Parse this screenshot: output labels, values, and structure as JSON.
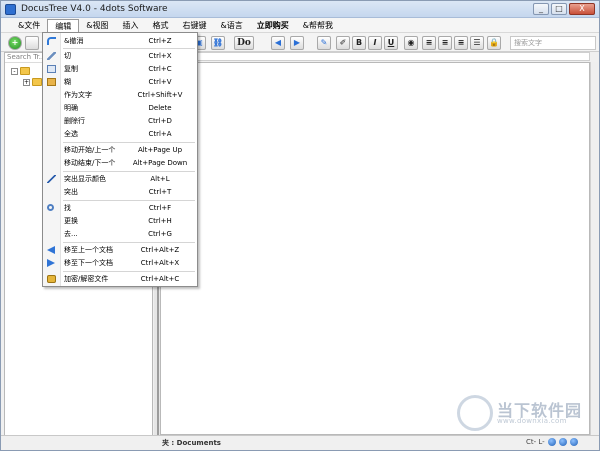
{
  "window": {
    "title": "DocusTree V4.0 - 4dots Software",
    "buttons": [
      "_",
      "□",
      "X"
    ]
  },
  "menubar": {
    "items": [
      "&文件",
      "编辑",
      "&视图",
      "插入",
      "格式",
      "右键键",
      "&语言",
      "立即购买",
      "&帮帮我"
    ],
    "active_index": 1
  },
  "toolbar": {
    "do_label": "Do",
    "bold_label": "B",
    "italic_label": "I",
    "underline_label": "U",
    "search_placeholder": "搜索文字"
  },
  "left_panel": {
    "search_placeholder": "Search Tr...",
    "tree_expand": "-",
    "tree_expand2": "+"
  },
  "edit_menu": {
    "items": [
      {
        "label": "&撤消",
        "shortcut": "Ctrl+Z",
        "icon": "undo-icon"
      },
      {
        "label": "切",
        "shortcut": "Ctrl+X",
        "icon": "cut-icon"
      },
      {
        "label": "复制",
        "shortcut": "Ctrl+C",
        "icon": "copy-icon"
      },
      {
        "label": "糊",
        "shortcut": "Ctrl+V",
        "icon": "paste-icon"
      },
      {
        "label": "作为文字",
        "shortcut": "Ctrl+Shift+V",
        "icon": ""
      },
      {
        "label": "明确",
        "shortcut": "Delete",
        "icon": ""
      },
      {
        "label": "删除行",
        "shortcut": "Ctrl+D",
        "icon": ""
      },
      {
        "label": "全选",
        "shortcut": "Ctrl+A",
        "icon": ""
      },
      {
        "label": "移动开始/上一个",
        "shortcut": "Alt+Page Up",
        "icon": ""
      },
      {
        "label": "移动结束/下一个",
        "shortcut": "Alt+Page Down",
        "icon": ""
      },
      {
        "label": "突出显示颜色",
        "shortcut": "Alt+L",
        "icon": "pen-icon"
      },
      {
        "label": "突出",
        "shortcut": "Ctrl+T",
        "icon": ""
      },
      {
        "label": "找",
        "shortcut": "Ctrl+F",
        "icon": "find-icon"
      },
      {
        "label": "更换",
        "shortcut": "Ctrl+H",
        "icon": ""
      },
      {
        "label": "去...",
        "shortcut": "Ctrl+G",
        "icon": ""
      },
      {
        "label": "移至上一个文档",
        "shortcut": "Ctrl+Alt+Z",
        "icon": "arrow-left-icon"
      },
      {
        "label": "移至下一个文档",
        "shortcut": "Ctrl+Alt+X",
        "icon": "arrow-right-icon"
      },
      {
        "label": "加密/解密文件",
        "shortcut": "Ctrl+Alt+C",
        "icon": "lock-icon"
      }
    ]
  },
  "statusbar": {
    "folder_text": "夹 : Documents",
    "right_text": "Ct-  L-"
  },
  "watermark": {
    "brand": "当下软件园",
    "sub": "www.downxia.com"
  }
}
